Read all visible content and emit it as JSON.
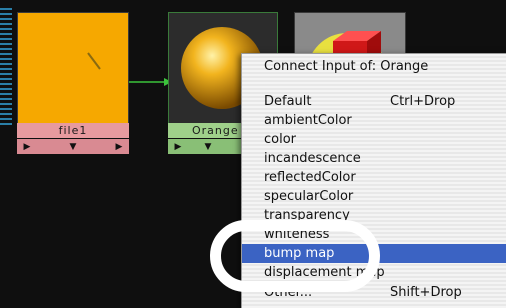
{
  "nodes": [
    {
      "label": "file1"
    },
    {
      "label": "Orange"
    }
  ],
  "menu": {
    "title": "Connect Input of: Orange",
    "items": [
      {
        "label": "Default",
        "shortcut": "Ctrl+Drop"
      },
      {
        "label": "ambientColor"
      },
      {
        "label": "color"
      },
      {
        "label": "incandescence"
      },
      {
        "label": "reflectedColor"
      },
      {
        "label": "specularColor"
      },
      {
        "label": "transparency"
      },
      {
        "label": "whiteness"
      },
      {
        "label": "bump map",
        "selected": true
      },
      {
        "label": "displacement map"
      },
      {
        "label": "Other...",
        "shortcut": "Shift+Drop"
      }
    ]
  },
  "colors": {
    "file_swatch": "#f6a800",
    "file_label_bg": "#e79a9f",
    "orange_label_bg": "#9fd08a",
    "selection": "#3b63c3"
  }
}
